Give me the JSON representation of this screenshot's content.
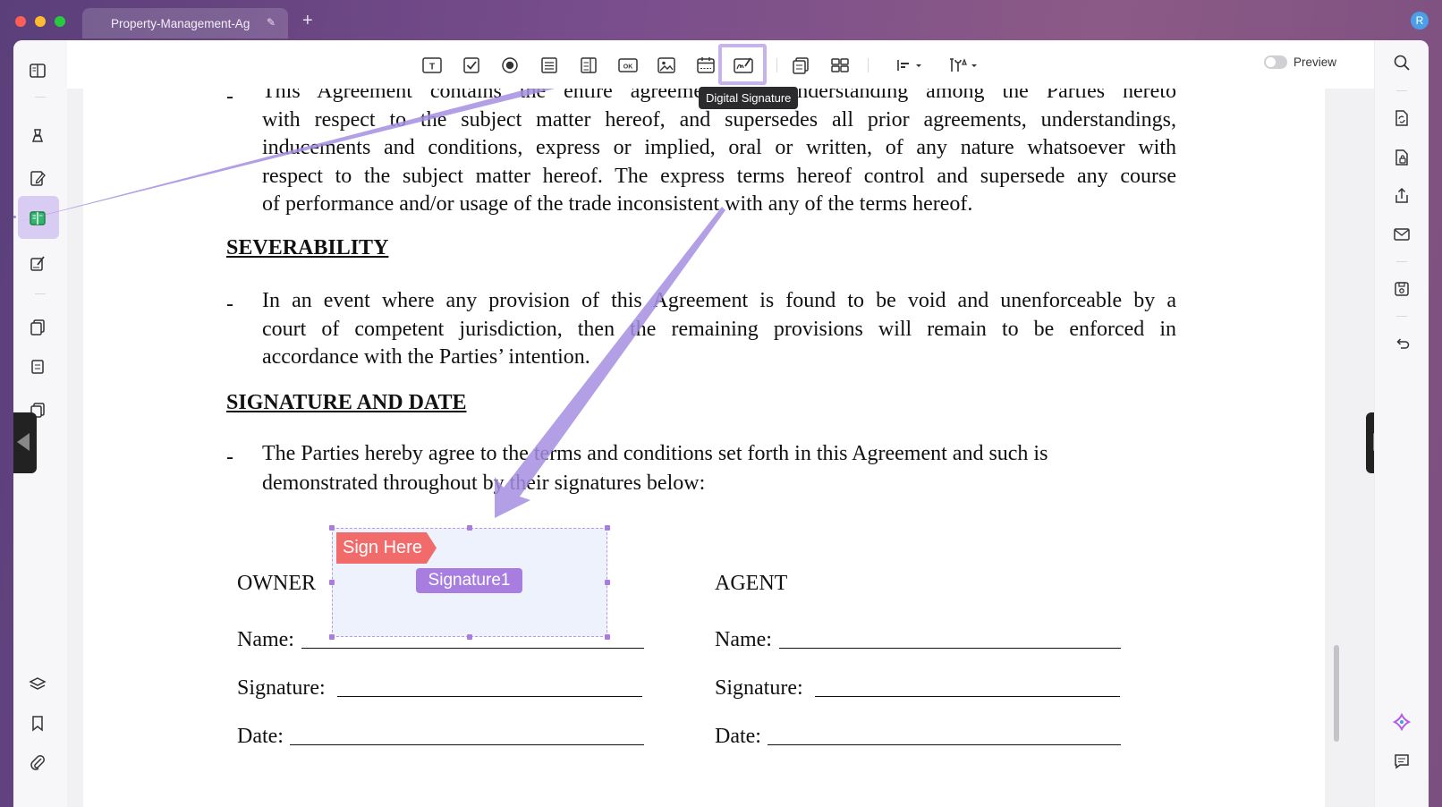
{
  "window": {
    "tab_title": "Property-Management-Ag",
    "new_tab": "+",
    "avatar_initial": "R"
  },
  "toolbar": {
    "tooltip": "Digital Signature",
    "preview_label": "Preview",
    "tools": [
      "text-field",
      "checkbox",
      "radio-button",
      "list-box",
      "combo-box",
      "button",
      "image-field",
      "date-field",
      "digital-signature",
      "duplicate",
      "grid",
      "align",
      "properties"
    ]
  },
  "document": {
    "para_agreement": [
      "This Agreement contains the entire agreement and understanding among the Parties hereto",
      "with respect to the subject matter hereof, and supersedes all prior agreements, understandings,",
      "inducements and conditions, express or implied, oral or written, of any nature whatsoever with",
      "respect to the subject matter hereof. The express terms hereof control and supersede any course",
      "of performance and/or usage of the trade inconsistent with any of the terms hereof."
    ],
    "heading_severability": "SEVERABILITY",
    "para_severability": [
      "In an event where any provision of this Agreement is found to be void and unenforceable by a",
      "court of competent jurisdiction, then the remaining provisions will remain to be enforced in",
      "accordance with the Parties’ intention."
    ],
    "heading_signature": "SIGNATURE AND DATE",
    "para_signature": [
      "The Parties hereby agree to the terms and conditions set forth in this Agreement and such is",
      "demonstrated throughout by their signatures below:"
    ],
    "bullet": "-",
    "owner_label": "OWNER",
    "agent_label": "AGENT",
    "name_label": "Name:",
    "signature_label": "Signature:",
    "date_label": "Date:",
    "sign_here": "Sign Here",
    "signature_field": "Signature1"
  },
  "colors": {
    "accent": "#a77ee0",
    "sign_here": "#f26b6b",
    "field_fill": "#eef2fc"
  }
}
